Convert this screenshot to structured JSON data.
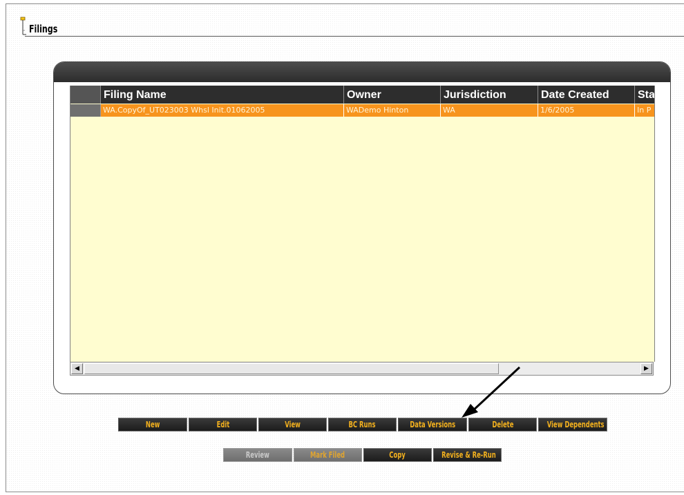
{
  "page": {
    "title": "Filings"
  },
  "grid": {
    "columns": [
      "Filing Name",
      "Owner",
      "Jurisdiction",
      "Date Created",
      "Sta"
    ],
    "rows": [
      {
        "filing_name": "WA.CopyOf_UT023003 Whsl Init.01062005",
        "owner": "WADemo Hinton",
        "jurisdiction": "WA",
        "date_created": "1/6/2005",
        "status": "In P"
      }
    ]
  },
  "scrollbar": {
    "left_arrow": "◀",
    "right_arrow": "▶"
  },
  "buttons": {
    "row1": [
      "New",
      "Edit",
      "View",
      "BC Runs",
      "Data Versions",
      "Delete",
      "View Dependents"
    ],
    "row2": [
      "Review",
      "Mark Filed",
      "Copy",
      "Revise & Re-Run"
    ]
  },
  "colors": {
    "selected_row": "#f7941d",
    "grid_background": "#fffdd0",
    "header_background": "#2d2d2d",
    "button_text": "#f2b01e"
  }
}
